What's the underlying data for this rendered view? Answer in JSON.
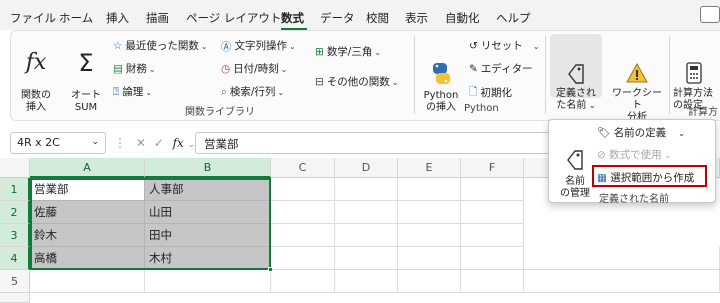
{
  "menu": {
    "tabs": [
      "ファイル",
      "ホーム",
      "挿入",
      "描画",
      "ページ レイアウト",
      "数式",
      "データ",
      "校閲",
      "表示",
      "自動化",
      "ヘルプ"
    ],
    "active_tab": "数式"
  },
  "ribbon": {
    "insert_function": "関数の\n挿入",
    "autosum": "オート\nSUM",
    "recently_used": "最近使った関数",
    "financial": "財務",
    "logical": "論理",
    "text": "文字列操作",
    "datetime": "日付/時刻",
    "lookup": "検索/行列",
    "math": "数学/三角",
    "more_functions": "その他の関数",
    "function_library_label": "関数ライブラリ",
    "insert_python": "Python\nの挿入",
    "reset": "リセット",
    "editor": "エディター",
    "initialize": "初期化",
    "python_label": "Python",
    "defined_names": "定義され\nた名前",
    "watch_window": "ワークシート\n分析",
    "calc_options": "計算方法\nの設定",
    "calc_label": "計算方"
  },
  "formula_bar": {
    "name_box": "4R x 2C",
    "fx": "fx",
    "value": "営業部"
  },
  "grid": {
    "columns": [
      "A",
      "B",
      "C",
      "D",
      "E",
      "F"
    ],
    "rows": [
      "1",
      "2",
      "3",
      "4",
      "5"
    ],
    "cells": [
      [
        "営業部",
        "人事部"
      ],
      [
        "佐藤",
        "山田"
      ],
      [
        "鈴木",
        "田中"
      ],
      [
        "高橋",
        "木村"
      ]
    ]
  },
  "dropdown": {
    "name_manager": "名前\nの管理",
    "define_name": "名前の定義",
    "use_in_formula": "数式で使用",
    "create_from_selection": "選択範囲から作成",
    "group_label": "定義された名前"
  },
  "colors": {
    "accent": "#117a3d",
    "highlight_border": "#c00000",
    "selection_fill": "#c6c6c6"
  }
}
